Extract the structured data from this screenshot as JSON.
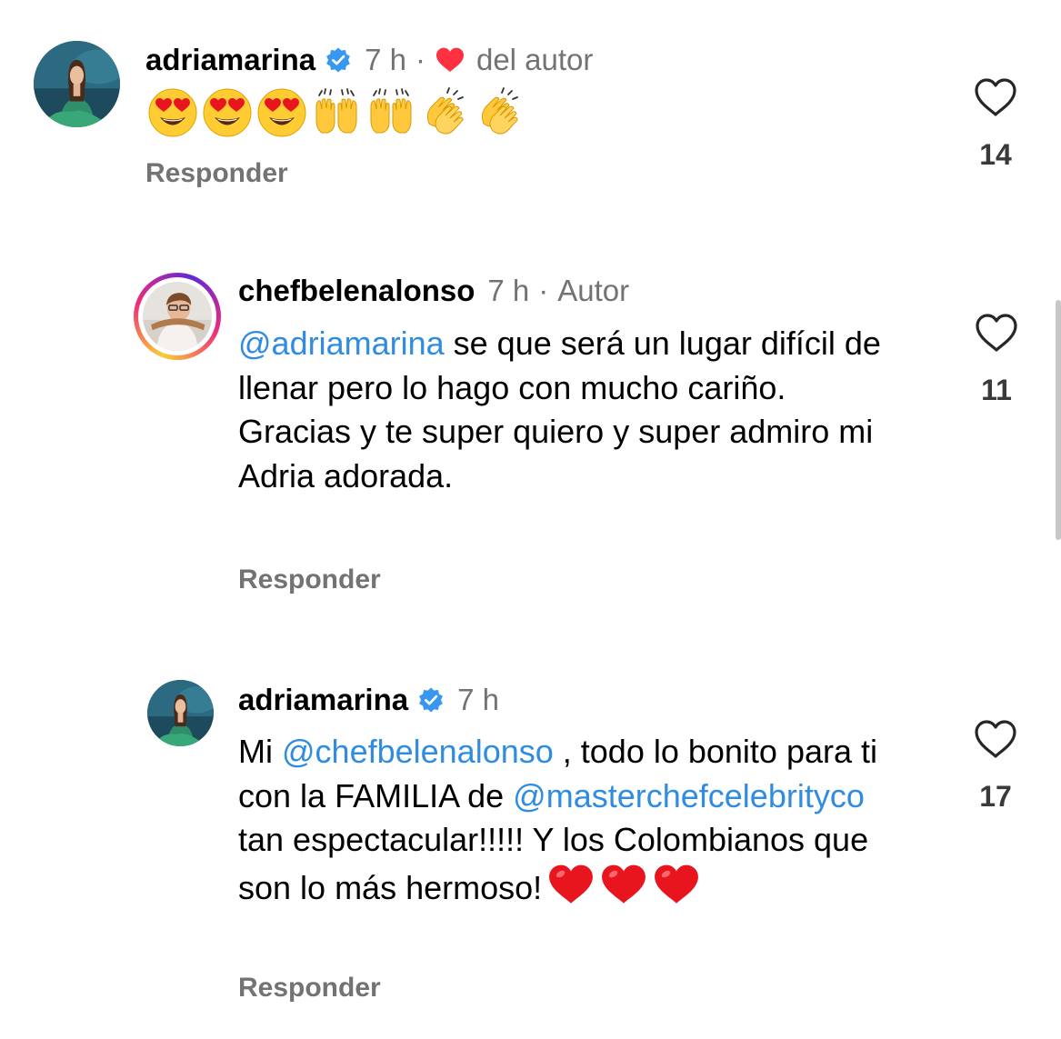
{
  "comments": [
    {
      "username": "adriamarina",
      "verified": true,
      "time": "7 h",
      "separator": "·",
      "liked_by_author_label": "del autor",
      "emojis": [
        "heart-eyes-emoji",
        "heart-eyes-emoji",
        "heart-eyes-emoji",
        "raising-hands-emoji",
        "raising-hands-emoji",
        "clapping-hands-emoji",
        "clapping-hands-emoji"
      ],
      "reply_label": "Responder",
      "likes": "14"
    },
    {
      "username": "chefbelenalonso",
      "time": "7 h",
      "separator": "·",
      "author_label": "Autor",
      "mention": "@adriamarina",
      "text": " se que será un lugar difícil de llenar pero lo hago con mucho cariño. Gracias y te super quiero y super admiro mi Adria adorada.",
      "reply_label": "Responder",
      "likes": "11"
    },
    {
      "username": "adriamarina",
      "verified": true,
      "time": "7 h",
      "text_prefix": "Mi ",
      "mention1": "@chefbelenalonso",
      "text_mid": " , todo lo bonito para ti con la FAMILIA de ",
      "mention2": "@masterchefcelebrityco",
      "text_end": " tan espectacular!!!!! Y los Colombianos que son lo más hermoso!",
      "reply_label": "Responder",
      "likes": "17"
    }
  ],
  "colors": {
    "mention": "#2f8ce0",
    "meta": "#737373",
    "verified": "#3897f0",
    "heart": "#ff3040"
  }
}
